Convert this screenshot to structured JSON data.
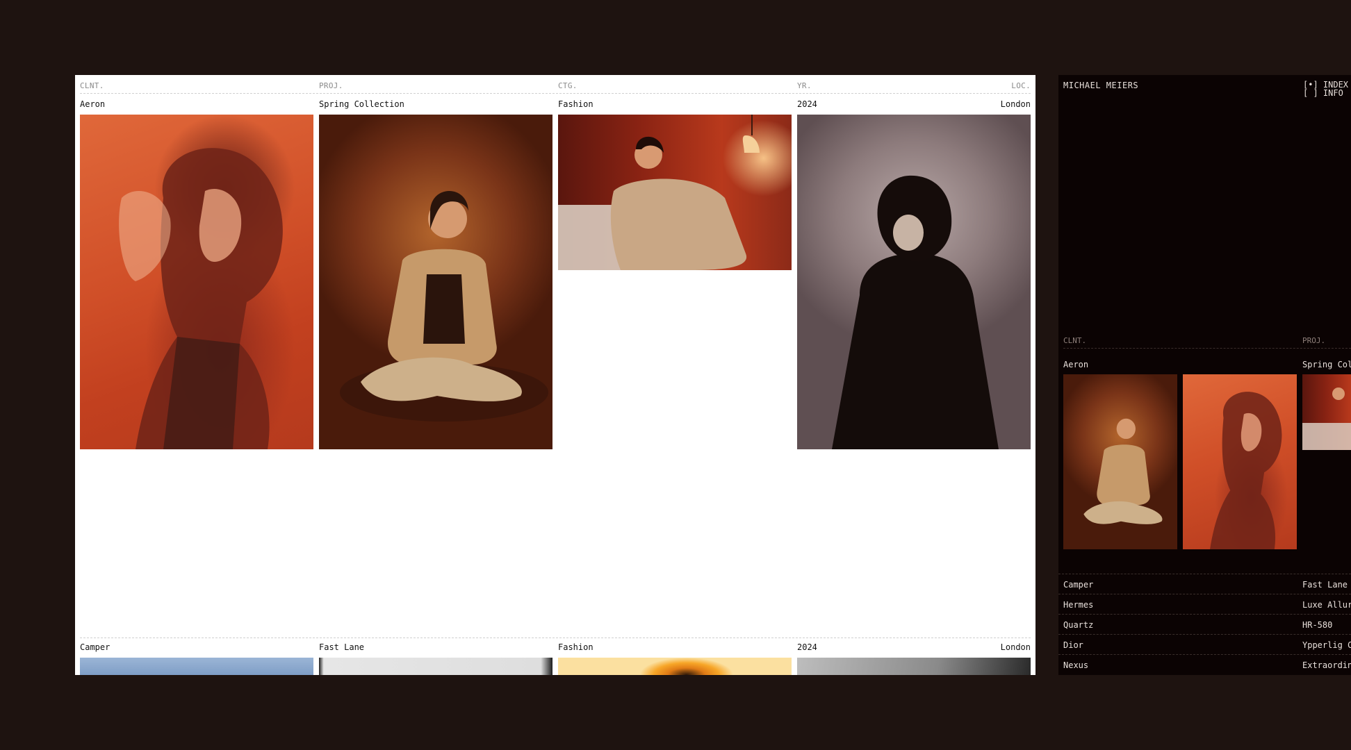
{
  "header": {
    "columns": [
      "CLNT.",
      "PROJ.",
      "CTG.",
      "YR.",
      "LOC."
    ]
  },
  "projects": [
    {
      "client": "Aeron",
      "project": "Spring Collection",
      "category": "Fashion",
      "year": "2024",
      "location": "London"
    },
    {
      "client": "Camper",
      "project": "Fast Lane",
      "category": "Fashion",
      "year": "2024",
      "location": "London"
    }
  ],
  "sidebar": {
    "name": "MICHAEL MEIERS",
    "menu": [
      "[•] INDEX",
      "[ ] INFO"
    ],
    "columns": [
      "CLNT.",
      "PROJ."
    ],
    "selected": {
      "client": "Aeron",
      "project": "Spring Col"
    },
    "list": [
      {
        "client": "Camper",
        "project": "Fast Lane"
      },
      {
        "client": "Hermes",
        "project": "Luxe Allur"
      },
      {
        "client": "Quartz",
        "project": "HR-580"
      },
      {
        "client": "Dior",
        "project": "Ypperlig C"
      },
      {
        "client": "Nexus",
        "project": "Extraordin"
      }
    ]
  },
  "colors": {
    "background": "#1e1310",
    "panel_light": "#ffffff",
    "panel_dark": "#0b0303",
    "accent_orange": "#d8542a"
  }
}
